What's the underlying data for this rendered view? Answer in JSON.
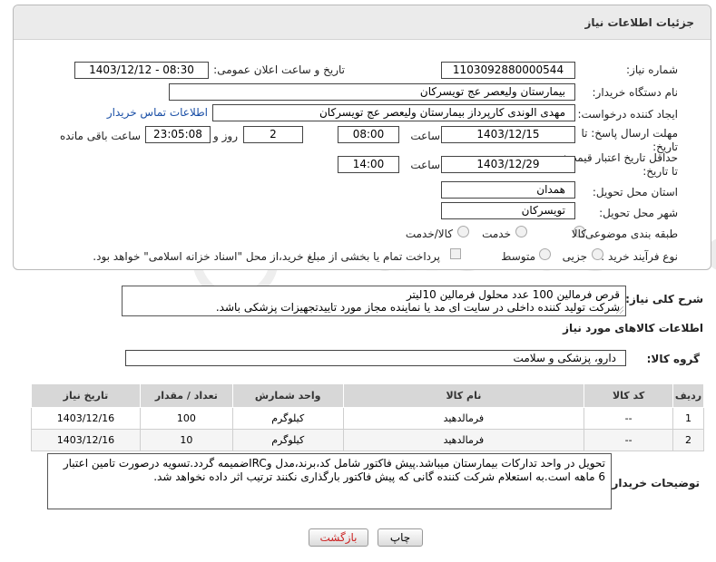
{
  "panel": {
    "title": "جزئیات اطلاعات نیاز"
  },
  "fields": {
    "need_number_label": "شماره نیاز:",
    "need_number_value": "1103092880000544",
    "announce_label": "تاریخ و ساعت اعلان عمومی:",
    "announce_value": "1403/12/12 - 08:30",
    "buyer_org_label": "نام دستگاه خریدار:",
    "buyer_org_value": "بیمارستان ولیعصر  عج  تویسرکان",
    "requester_label": "ایجاد کننده درخواست:",
    "requester_value": "مهدی الوندی کارپرداز بیمارستان ولیعصر  عج  تویسرکان",
    "contact_link": "اطلاعات تماس خریدار",
    "send_deadline_label": "مهلت ارسال پاسخ: تا تاریخ:",
    "send_deadline_date": "1403/12/15",
    "time_label": "ساعت",
    "send_deadline_time": "08:00",
    "days_value": "2",
    "days_label": "روز و",
    "remaining_time": "23:05:08",
    "remaining_label": "ساعت باقی مانده",
    "validity_label": "حداقل تاریخ اعتبار قیمت: تا تاریخ:",
    "validity_date": "1403/12/29",
    "validity_time": "14:00",
    "province_label": "استان محل تحویل:",
    "province_value": "همدان",
    "city_label": "شهر محل تحویل:",
    "city_value": "تویسرکان",
    "category_label": "طبقه بندی موضوعی:",
    "category_options": [
      "کالا",
      "خدمت",
      "کالا/خدمت"
    ],
    "process_label": "نوع فرآیند خرید :",
    "process_options": [
      "جزیی",
      "متوسط"
    ],
    "payment_note": "پرداخت تمام یا بخشی از مبلغ خرید،از محل \"اسناد خزانه اسلامی\" خواهد بود."
  },
  "description": {
    "label": "شرح کلی نیاز:",
    "line1": "قرص فرمالین 100 عدد محلول فرمالین 10لیتر",
    "line2": "شرکت تولید کننده داخلی در سایت ای مد یا نماینده مجاز مورد تاییدتجهیزات پزشکی باشد."
  },
  "goods": {
    "section_title": "اطلاعات کالاهای مورد نیاز",
    "group_label": "گروه کالا:",
    "group_value": "دارو، پزشکی و سلامت",
    "columns": [
      "ردیف",
      "کد کالا",
      "نام کالا",
      "واحد شمارش",
      "تعداد / مقدار",
      "تاریخ نیاز"
    ],
    "rows": [
      {
        "idx": "1",
        "code": "--",
        "name": "فرمالدهید",
        "unit": "کیلوگرم",
        "qty": "100",
        "date": "1403/12/16"
      },
      {
        "idx": "2",
        "code": "--",
        "name": "فرمالدهید",
        "unit": "کیلوگرم",
        "qty": "10",
        "date": "1403/12/16"
      }
    ]
  },
  "buyer_notes": {
    "label": "توضیحات خریدار:",
    "text": "تحویل در واحد تدارکات بیمارستان میباشد.پیش فاکتور شامل کد،برند،مدل وIRCضمیمه گردد.تسویه درصورت تامین اعتبار 6 ماهه است.به استعلام شرکت کننده گانی که پیش فاکتور بارگذاری نکنند ترتیب اثر داده نخواهد شد."
  },
  "buttons": {
    "print": "چاپ",
    "back": "بازگشت"
  },
  "watermark": "AriaTender.net",
  "colors": {
    "link": "#1a4fa6",
    "back_text": "#c22222",
    "header_bg": "#ebebeb"
  }
}
